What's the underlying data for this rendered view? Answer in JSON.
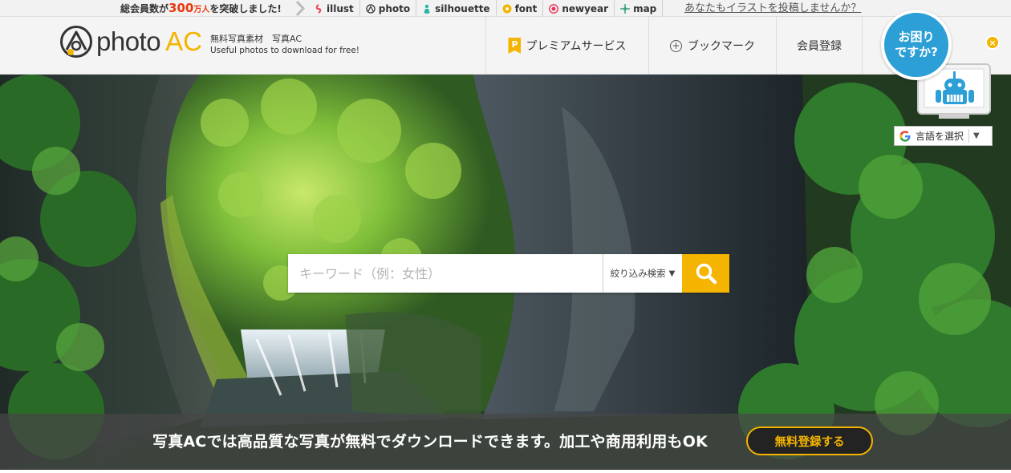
{
  "topbar": {
    "members_prefix": "総会員数が",
    "members_count": "300",
    "members_unit": "万人",
    "members_suffix": "を突破しました!",
    "sites": [
      {
        "label": "illust",
        "color": "#e8485a"
      },
      {
        "label": "photo",
        "color": "#333333"
      },
      {
        "label": "silhouette",
        "color": "#2bb5a8"
      },
      {
        "label": "font",
        "color": "#f5b400"
      },
      {
        "label": "newyear",
        "color": "#e8385a"
      },
      {
        "label": "map",
        "color": "#3aa37a"
      }
    ],
    "post_link": "あなたもイラストを投稿しませんか？"
  },
  "header": {
    "logo_photo": "photo",
    "logo_ac": "AC",
    "tagline_jp": "無料写真素材　写真AC",
    "tagline_en": "Useful photos to download for free!",
    "nav": {
      "premium_badge": "P",
      "premium": "プレミアムサービス",
      "bookmark": "ブックマーク",
      "register": "会員登録"
    }
  },
  "hero": {
    "search_placeholder": "キーワード（例：女性）",
    "search_value": "",
    "refine_label": "絞り込み検索",
    "promo_text": "写真ACでは高品質な写真が無料でダウンロードできます。加工や商用利用もOK",
    "promo_button": "無料登録する"
  },
  "help": {
    "line1": "お困り",
    "line2": "ですか?",
    "close": "×"
  },
  "translate": {
    "label": "言語を選択"
  },
  "colors": {
    "brand_yellow": "#f5b400",
    "help_blue": "#2b9fd6",
    "accent_red": "#e8380d"
  }
}
